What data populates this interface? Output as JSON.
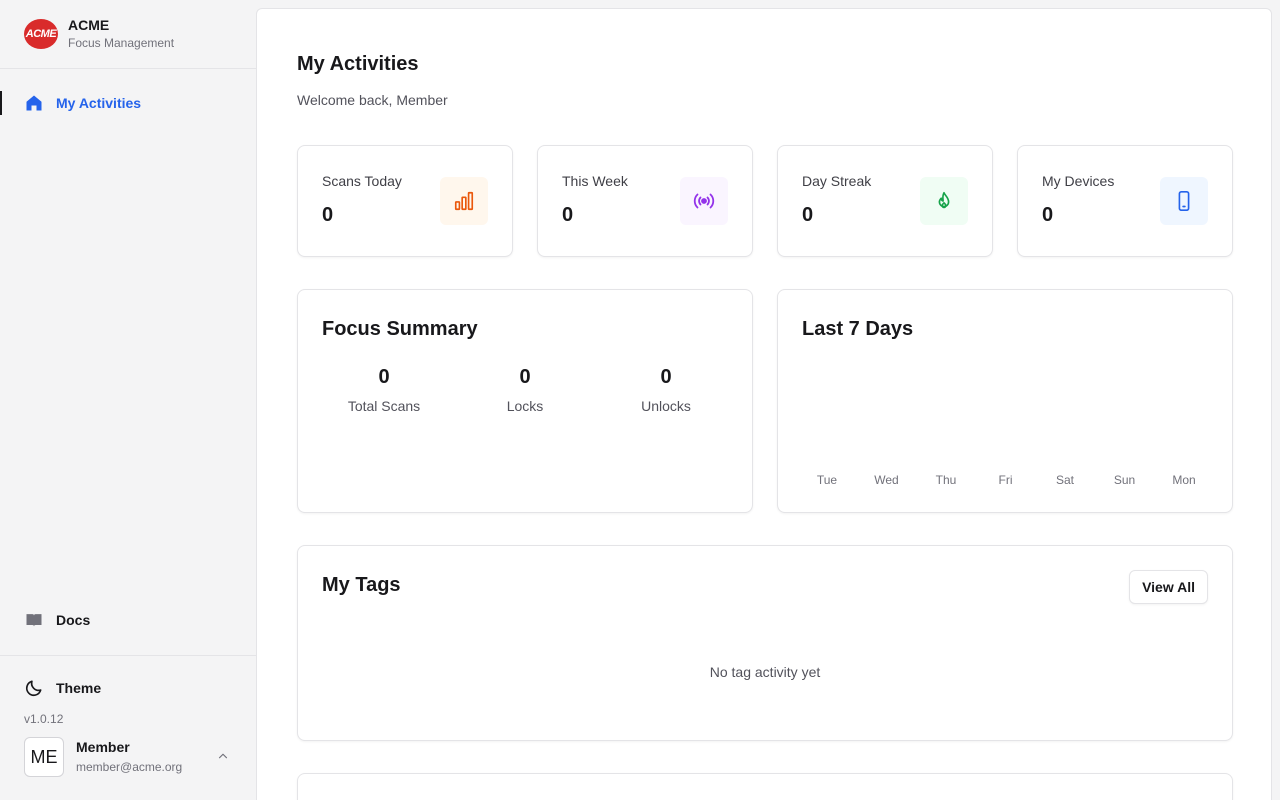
{
  "brand": {
    "logo_text": "ACME",
    "name": "ACME",
    "subtitle": "Focus Management"
  },
  "nav": {
    "items": [
      {
        "label": "My Activities",
        "icon": "home-icon",
        "active": true
      }
    ]
  },
  "docs": {
    "label": "Docs",
    "icon": "book-icon"
  },
  "theme": {
    "label": "Theme",
    "icon": "moon-icon"
  },
  "version": "v1.0.12",
  "user": {
    "initials": "ME",
    "name": "Member",
    "email": "member@acme.org"
  },
  "page": {
    "title": "My Activities",
    "subtitle": "Welcome back, Member"
  },
  "stats": [
    {
      "label": "Scans Today",
      "value": "0",
      "icon": "bar-chart-icon",
      "color": "#ea580c",
      "bg": "#fff7ed"
    },
    {
      "label": "This Week",
      "value": "0",
      "icon": "broadcast-icon",
      "color": "#9333ea",
      "bg": "#faf5ff"
    },
    {
      "label": "Day Streak",
      "value": "0",
      "icon": "flame-icon",
      "color": "#16a34a",
      "bg": "#f0fdf4"
    },
    {
      "label": "My Devices",
      "value": "0",
      "icon": "smartphone-icon",
      "color": "#2563eb",
      "bg": "#eff6ff"
    }
  ],
  "focus_summary": {
    "title": "Focus Summary",
    "items": [
      {
        "value": "0",
        "label": "Total Scans"
      },
      {
        "value": "0",
        "label": "Locks"
      },
      {
        "value": "0",
        "label": "Unlocks"
      }
    ]
  },
  "last7": {
    "title": "Last 7 Days",
    "days": [
      "Tue",
      "Wed",
      "Thu",
      "Fri",
      "Sat",
      "Sun",
      "Mon"
    ]
  },
  "tags": {
    "title": "My Tags",
    "view_all_label": "View All",
    "empty": "No tag activity yet"
  },
  "colors": {
    "accent": "#2563eb",
    "logo": "#d92b2b"
  }
}
